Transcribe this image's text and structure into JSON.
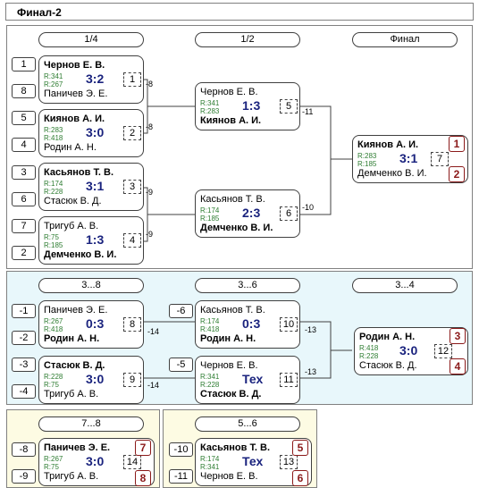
{
  "window_title": "Финал-2",
  "rounds": {
    "r14": "1/4",
    "r12": "1/2",
    "final": "Финал",
    "r38": "3...8",
    "r36": "3...6",
    "r34": "3...4",
    "r78": "7...8",
    "r56": "5...6"
  },
  "seeds": {
    "s1": "1",
    "s8": "8",
    "s5": "5",
    "s4": "4",
    "s3": "3",
    "s6": "6",
    "s7": "7",
    "s2": "2",
    "l1": "-1",
    "l2": "-2",
    "l3": "-3",
    "l4": "-4",
    "l6": "-6",
    "l5": "-5",
    "l8": "-8",
    "l9": "-9",
    "l10": "-10",
    "l11": "-11"
  },
  "matches": {
    "m1": {
      "p1": "Чернов Е. В.",
      "r1": "R:341",
      "r2": "R:267",
      "p2": "Паничев Э. Е.",
      "score": "3:2",
      "num": "1",
      "next": "-8"
    },
    "m2": {
      "p1": "Киянов А. И.",
      "r1": "R:283",
      "r2": "R:418",
      "p2": "Родин А. Н.",
      "score": "3:0",
      "num": "2",
      "next": "-8"
    },
    "m3": {
      "p1": "Касьянов Т. В.",
      "r1": "R:174",
      "r2": "R:228",
      "p2": "Стасюк В. Д.",
      "score": "3:1",
      "num": "3",
      "next": "-9"
    },
    "m4": {
      "p1": "Тригуб А. В.",
      "r1": "R:75",
      "r2": "R:185",
      "p2": "Демченко В. И.",
      "score": "1:3",
      "num": "4",
      "next": "-9"
    },
    "m5": {
      "p1": "Чернов Е. В.",
      "r1": "R:341",
      "r2": "R:283",
      "p2": "Киянов А. И.",
      "score": "1:3",
      "num": "5",
      "next": "-11"
    },
    "m6": {
      "p1": "Касьянов Т. В.",
      "r1": "R:174",
      "r2": "R:185",
      "p2": "Демченко В. И.",
      "score": "2:3",
      "num": "6",
      "next": "-10"
    },
    "m7": {
      "p1": "Киянов А. И.",
      "r1": "R:283",
      "r2": "R:185",
      "p2": "Демченко В. И.",
      "score": "3:1",
      "num": "7",
      "place1": "1",
      "place2": "2"
    },
    "m8": {
      "p1": "Паничев Э. Е.",
      "r1": "R:267",
      "r2": "R:418",
      "p2": "Родин А. Н.",
      "score": "0:3",
      "num": "8",
      "next": "-14"
    },
    "m9": {
      "p1": "Стасюк В. Д.",
      "r1": "R:228",
      "r2": "R:75",
      "p2": "Тригуб А. В.",
      "score": "3:0",
      "num": "9",
      "next": "-14"
    },
    "m10": {
      "p1": "Касьянов Т. В.",
      "r1": "R:174",
      "r2": "R:418",
      "p2": "Родин А. Н.",
      "score": "0:3",
      "num": "10",
      "next": "-13"
    },
    "m11": {
      "p1": "Чернов Е. В.",
      "r1": "R:341",
      "r2": "R:228",
      "p2": "Стасюк В. Д.",
      "score": "Тех",
      "num": "11",
      "next": "-13"
    },
    "m12": {
      "p1": "Родин А. Н.",
      "r1": "R:418",
      "r2": "R:228",
      "p2": "Стасюк В. Д.",
      "score": "3:0",
      "num": "12",
      "place1": "3",
      "place2": "4"
    },
    "m14": {
      "p1": "Паничев Э. Е.",
      "r1": "R:267",
      "r2": "R:75",
      "p2": "Тригуб А. В.",
      "score": "3:0",
      "num": "14",
      "place1": "7",
      "place2": "8"
    },
    "m13": {
      "p1": "Касьянов Т. В.",
      "r1": "R:174",
      "r2": "R:341",
      "p2": "Чернов Е. В.",
      "score": "Тех",
      "num": "13",
      "place1": "5",
      "place2": "6"
    }
  },
  "colors": {
    "score": "#1a237e",
    "rating": "#2e7d32",
    "place": "#8b1a1a",
    "blue_panel": "#e8f7fb",
    "yellow_panel": "#fdfbe3"
  }
}
